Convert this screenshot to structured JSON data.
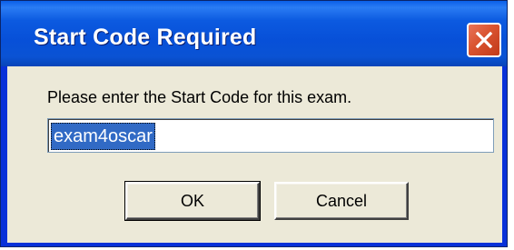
{
  "dialog": {
    "title": "Start Code Required",
    "close_icon": "close-icon",
    "prompt": "Please enter the Start Code for this exam.",
    "start_code_value": "exam4oscar",
    "ok_label": "OK",
    "cancel_label": "Cancel"
  },
  "colors": {
    "titlebar": "#0750d8",
    "client": "#ece9d8",
    "close_button": "#d9532f",
    "selection": "#316ac5"
  }
}
